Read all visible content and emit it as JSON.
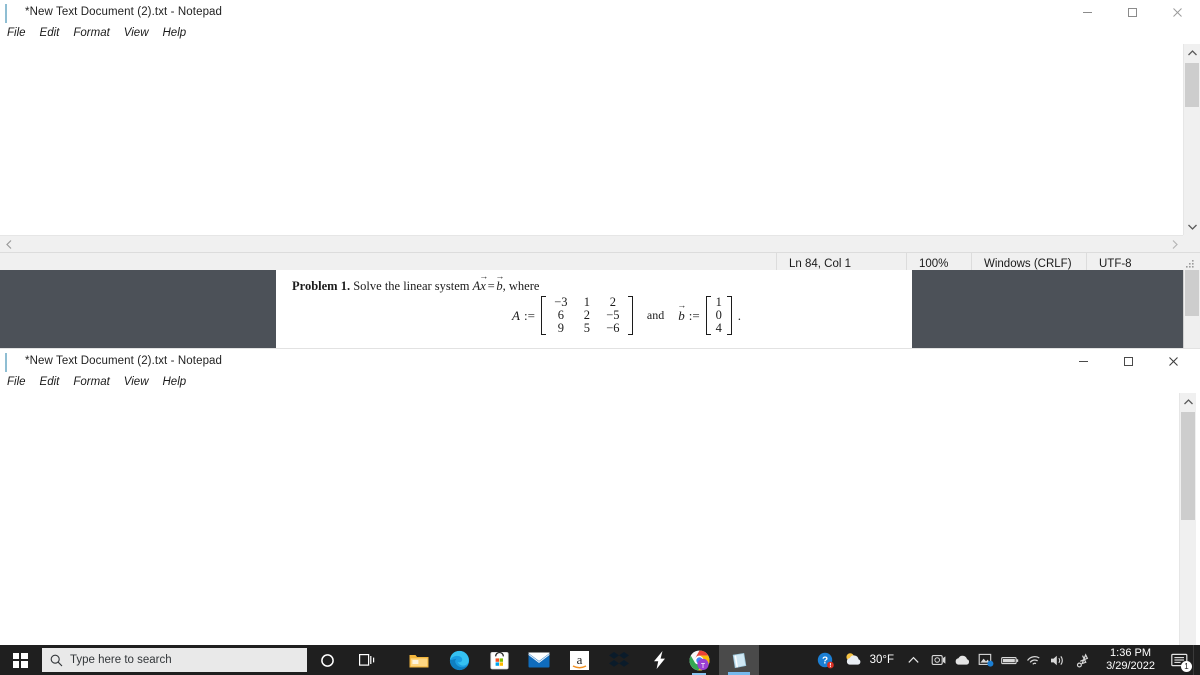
{
  "window1": {
    "title": "*New Text Document (2).txt - Notepad",
    "icon": "notepad-icon",
    "menu": [
      "File",
      "Edit",
      "Format",
      "View",
      "Help"
    ],
    "controls": {
      "minimize": "minimize-icon",
      "maximize": "maximize-icon",
      "close": "close-icon"
    },
    "status": {
      "position": "Ln 84, Col 1",
      "zoom": "100%",
      "line_ending": "Windows (CRLF)",
      "encoding": "UTF-8"
    }
  },
  "window2": {
    "title": "*New Text Document (2).txt - Notepad",
    "icon": "notepad-icon",
    "menu": [
      "File",
      "Edit",
      "Format",
      "View",
      "Help"
    ],
    "controls": {
      "minimize": "minimize-icon",
      "maximize": "maximize-icon",
      "close": "close-icon"
    }
  },
  "math_panel": {
    "problem_label": "Problem 1.",
    "problem_text_1": "Solve the linear system",
    "problem_text_2": ", where",
    "eq_system": "A x⃗ = b⃗",
    "A_label": "A",
    "b_label": "b",
    "assign": ":=",
    "conjunction": "and",
    "trailing_period": ".",
    "matrix_A": [
      [
        "−3",
        "1",
        "2"
      ],
      [
        "6",
        "2",
        "−5"
      ],
      [
        "9",
        "5",
        "−6"
      ]
    ],
    "vector_b": [
      "1",
      "0",
      "4"
    ]
  },
  "taskbar": {
    "start": "windows-start-icon",
    "search": {
      "placeholder": "Type here to search",
      "icon": "search-icon"
    },
    "buttons": [
      {
        "name": "cortana-button",
        "icon": "cortana-circle-icon"
      },
      {
        "name": "task-view-button",
        "icon": "task-view-icon"
      },
      {
        "name": "file-explorer-button",
        "icon": "file-explorer-icon"
      },
      {
        "name": "microsoft-edge-button",
        "icon": "edge-icon"
      },
      {
        "name": "microsoft-store-button",
        "icon": "store-icon"
      },
      {
        "name": "mail-button",
        "icon": "mail-icon"
      },
      {
        "name": "amazon-button",
        "icon": "amazon-icon"
      },
      {
        "name": "dropbox-button",
        "icon": "dropbox-icon"
      },
      {
        "name": "slack-button",
        "icon": "lightning-icon"
      },
      {
        "name": "chrome-button",
        "icon": "chrome-icon"
      },
      {
        "name": "notepad-button",
        "icon": "notepad-icon"
      }
    ],
    "tray": {
      "help": "help-question-icon",
      "weather_icon": "partly-cloudy-icon",
      "weather_temp": "30°F",
      "chevron": "chevron-up-icon",
      "icons": [
        "webcam-icon",
        "onedrive-cloud-icon",
        "photos-icon",
        "battery-icon",
        "wifi-icon",
        "volume-icon",
        "bluetooth-pen-icon"
      ],
      "time": "1:36 PM",
      "date": "3/29/2022",
      "notifications_icon": "notification-icon",
      "notifications_count": "1"
    }
  },
  "colors": {
    "taskbar_bg": "#1f1f1f",
    "overlay_dark": "#4c5158",
    "accent_blue": "#76b9ed",
    "scrollbar_thumb": "#cdcdcd"
  }
}
